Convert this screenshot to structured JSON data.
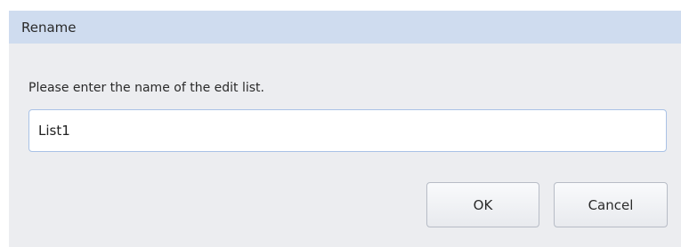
{
  "dialog": {
    "title": "Rename",
    "prompt": "Please enter the name of the edit list.",
    "input_value": "List1",
    "ok_label": "OK",
    "cancel_label": "Cancel"
  },
  "colors": {
    "titlebar": "#cfdcef",
    "body": "#ecedf0",
    "input_border": "#a9c2e6"
  }
}
